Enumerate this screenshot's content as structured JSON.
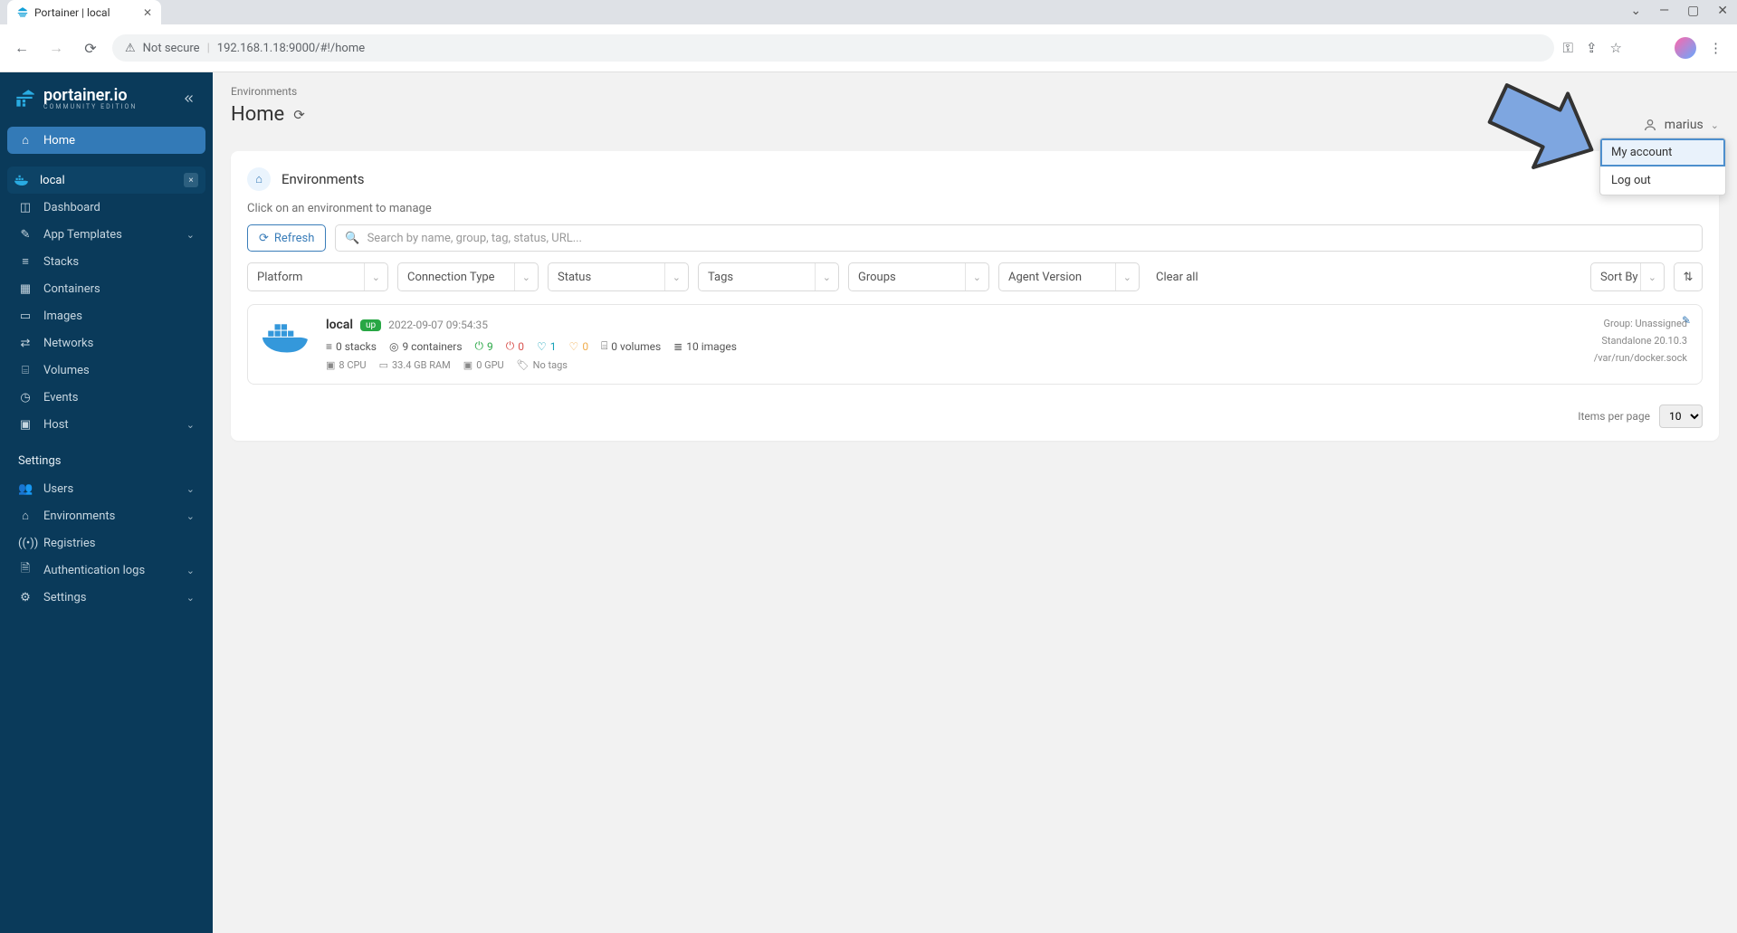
{
  "browser": {
    "tab_title": "Portainer | local",
    "not_secure_label": "Not secure",
    "url": "192.168.1.18:9000/#!/home"
  },
  "sidebar": {
    "logo_title": "portainer.io",
    "logo_sub": "COMMUNITY EDITION",
    "home": "Home",
    "env_pill": "local",
    "items": [
      {
        "label": "Dashboard",
        "icon": "◫"
      },
      {
        "label": "App Templates",
        "icon": "✎",
        "chev": true
      },
      {
        "label": "Stacks",
        "icon": "≡"
      },
      {
        "label": "Containers",
        "icon": "▦"
      },
      {
        "label": "Images",
        "icon": "▭"
      },
      {
        "label": "Networks",
        "icon": "⇄"
      },
      {
        "label": "Volumes",
        "icon": "⌸"
      },
      {
        "label": "Events",
        "icon": "◷"
      },
      {
        "label": "Host",
        "icon": "▣",
        "chev": true
      }
    ],
    "settings_head": "Settings",
    "settings_items": [
      {
        "label": "Users",
        "icon": "👥",
        "chev": true
      },
      {
        "label": "Environments",
        "icon": "⌂",
        "chev": true
      },
      {
        "label": "Registries",
        "icon": "((•))"
      },
      {
        "label": "Authentication logs",
        "icon": "🗎",
        "chev": true
      },
      {
        "label": "Settings",
        "icon": "⚙",
        "chev": true
      }
    ]
  },
  "header": {
    "breadcrumb": "Environments",
    "title": "Home",
    "username": "marius",
    "menu_my_account": "My account",
    "menu_logout": "Log out"
  },
  "panel": {
    "title": "Environments",
    "hint": "Click on an environment to manage",
    "refresh": "Refresh",
    "search_placeholder": "Search by name, group, tag, status, URL...",
    "filters": [
      "Platform",
      "Connection Type",
      "Status",
      "Tags",
      "Groups",
      "Agent Version"
    ],
    "clear_all": "Clear all",
    "sort_by": "Sort By"
  },
  "env": {
    "name": "local",
    "status_badge": "up",
    "timestamp": "2022-09-07 09:54:35",
    "stacks": "0 stacks",
    "containers": "9 containers",
    "power_green": "9",
    "power_red": "0",
    "heart_teal": "1",
    "heart_orange": "0",
    "volumes": "0 volumes",
    "images": "10 images",
    "cpu": "8 CPU",
    "ram": "33.4 GB RAM",
    "gpu": "0 GPU",
    "tags": "No tags",
    "group": "Group: Unassigned",
    "version": "Standalone 20.10.3",
    "socket": "/var/run/docker.sock"
  },
  "pager": {
    "label": "Items per page",
    "value": "10"
  }
}
